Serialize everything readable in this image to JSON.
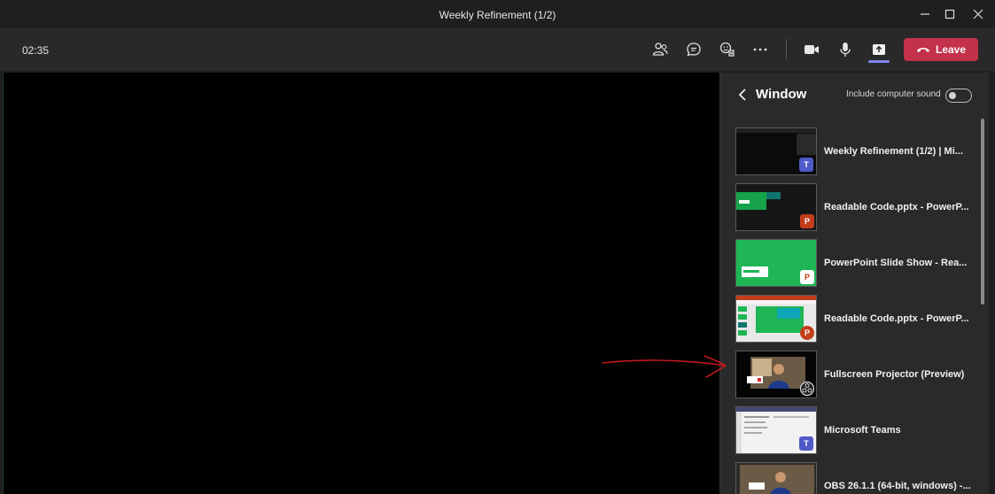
{
  "window": {
    "title": "Weekly Refinement (1/2)"
  },
  "toolbar": {
    "timer": "02:35",
    "leave_label": "Leave",
    "icons": [
      "people-icon",
      "chat-icon",
      "reactions-icon",
      "more-icon",
      "camera-icon",
      "mic-icon",
      "share-icon",
      "phone-hangup-icon"
    ],
    "colors": {
      "leave_bg": "#c4314b",
      "share_active": "#7f85f5"
    }
  },
  "share_panel": {
    "title": "Window",
    "include_sound_label": "Include computer sound",
    "include_sound_on": false,
    "windows": [
      {
        "label": "Weekly Refinement (1/2) | Mi...",
        "app_icon": "teams-icon"
      },
      {
        "label": "Readable Code.pptx - PowerP...",
        "app_icon": "powerpoint-icon"
      },
      {
        "label": "PowerPoint Slide Show - Rea...",
        "app_icon": "powerpoint-icon"
      },
      {
        "label": "Readable Code.pptx - PowerP...",
        "app_icon": "powerpoint-icon"
      },
      {
        "label": "Fullscreen Projector (Preview)",
        "app_icon": "obs-icon"
      },
      {
        "label": "Microsoft Teams",
        "app_icon": "teams-icon"
      },
      {
        "label": "OBS 26.1.1 (64-bit, windows) -...",
        "app_icon": "obs-icon"
      }
    ]
  },
  "annotation": {
    "arrow_color": "#c0191f",
    "points_to": "Fullscreen Projector (Preview)"
  }
}
